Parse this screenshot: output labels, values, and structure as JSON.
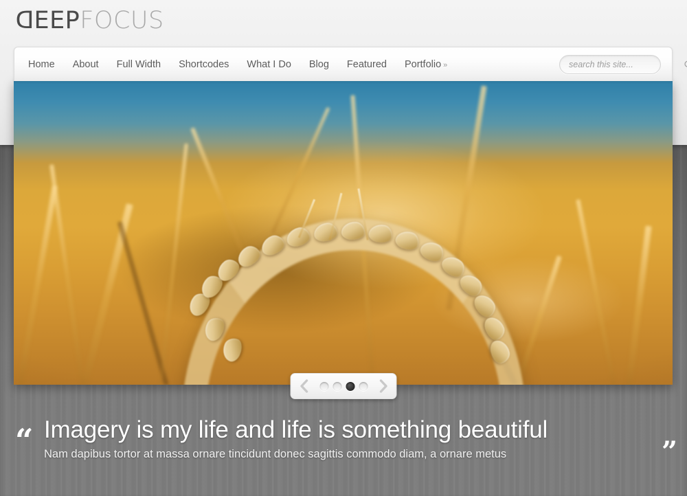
{
  "site": {
    "logo_primary": "DEEP",
    "logo_secondary": "FOCUS",
    "logo_primary_color": "#4a4a4a",
    "logo_secondary_color": "#a9a9a9",
    "background_top_color": "#eeeeee",
    "background_bottom_color": "#7a7a7a"
  },
  "nav": {
    "items": [
      {
        "label": "Home",
        "caret": ""
      },
      {
        "label": "About",
        "caret": ""
      },
      {
        "label": "Full Width",
        "caret": ""
      },
      {
        "label": "Shortcodes",
        "caret": ""
      },
      {
        "label": "What I Do",
        "caret": ""
      },
      {
        "label": "Blog",
        "caret": ""
      },
      {
        "label": "Featured",
        "caret": ""
      },
      {
        "label": "Portfolio",
        "caret": "»"
      }
    ]
  },
  "search": {
    "placeholder": "search this site...",
    "value": "",
    "icon": "search-icon"
  },
  "slider": {
    "current_index": 3,
    "total_slides": 4,
    "prev_label": "‹",
    "next_label": "›",
    "slide_alt": "Close-up photograph of a golden wheat ear against a blue sky and blurred wheat field",
    "dots": [
      {
        "index": 1,
        "active": false
      },
      {
        "index": 2,
        "active": false
      },
      {
        "index": 3,
        "active": true
      },
      {
        "index": 4,
        "active": false
      }
    ]
  },
  "quote": {
    "open_mark": "“",
    "close_mark": "”",
    "headline": "Imagery is my life and life is something beautiful",
    "subtext": "Nam dapibus tortor at massa ornare tincidunt donec sagittis commodo diam, a ornare metus"
  }
}
